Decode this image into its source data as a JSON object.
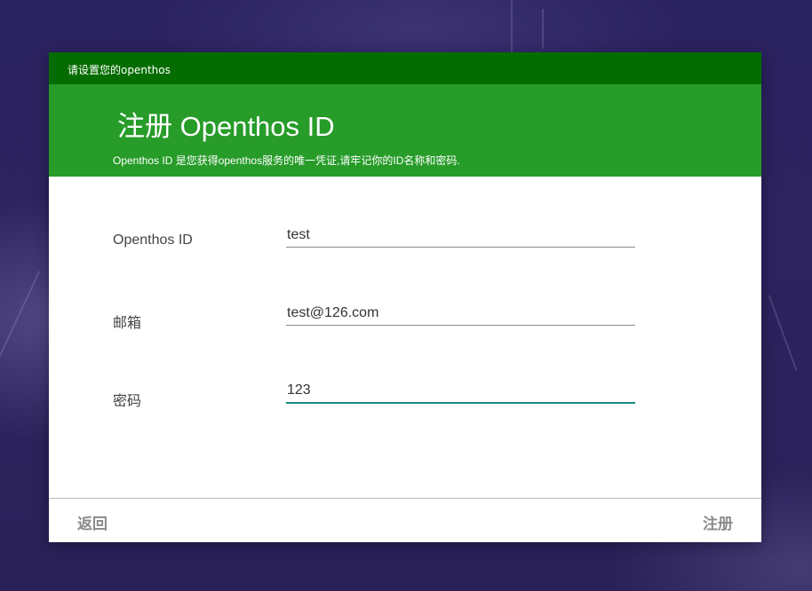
{
  "window": {
    "title": "请设置您的openthos"
  },
  "header": {
    "title": "注册 Openthos ID",
    "subtitle": "Openthos ID 是您获得openthos服务的唯一凭证,请牢记你的ID名称和密码."
  },
  "form": {
    "fields": [
      {
        "label": "Openthos ID",
        "value": "test",
        "focused": false
      },
      {
        "label": "邮箱",
        "value": "test@126.com",
        "focused": false
      },
      {
        "label": "密码",
        "value": "123",
        "focused": true
      }
    ]
  },
  "footer": {
    "back_label": "返回",
    "register_label": "注册"
  },
  "colors": {
    "topbar": "#056d00",
    "header": "#279c29",
    "focus_underline": "#1a8a80",
    "desktop": "#2a2160"
  }
}
